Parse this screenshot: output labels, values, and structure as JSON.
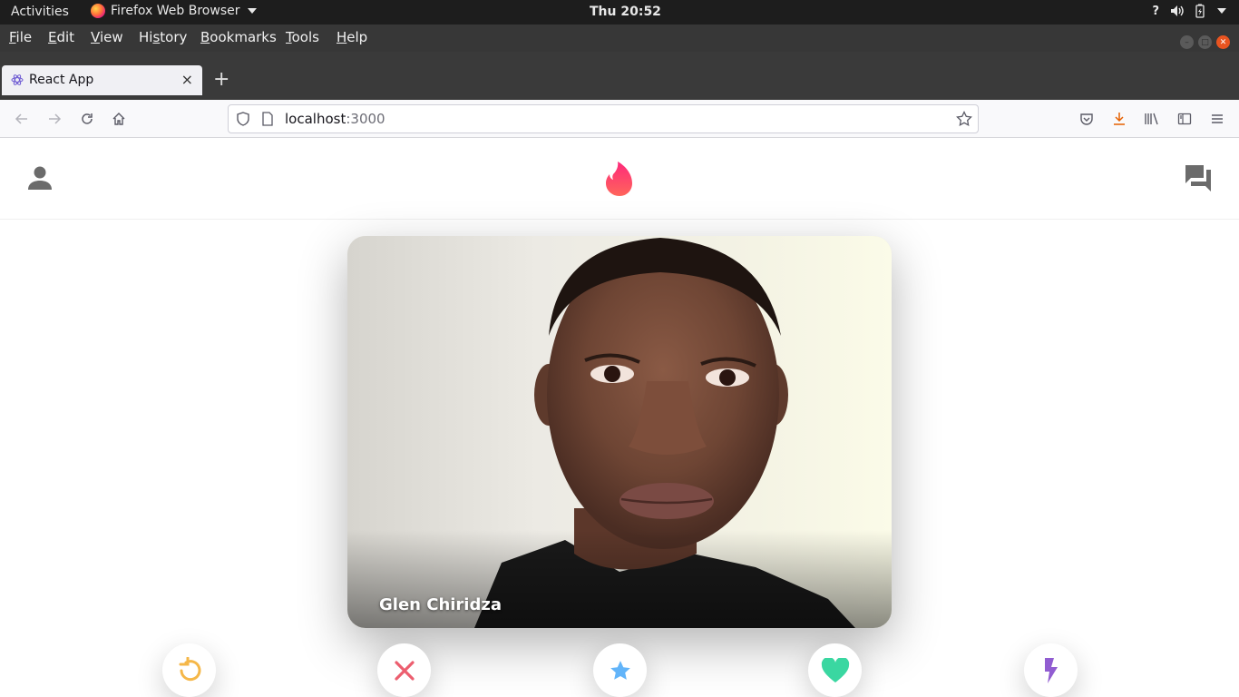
{
  "system": {
    "activities": "Activities",
    "app_name": "Firefox Web Browser",
    "clock": "Thu 20:52",
    "tray_help": "?"
  },
  "menubar": {
    "items": [
      {
        "accel": "F",
        "rest": "ile"
      },
      {
        "accel": "E",
        "rest": "dit"
      },
      {
        "accel": "V",
        "rest": "iew"
      },
      {
        "pre": "Hi",
        "accel": "s",
        "rest": "tory"
      },
      {
        "accel": "B",
        "rest": "ookmarks"
      },
      {
        "accel": "T",
        "rest": "ools"
      },
      {
        "accel": "H",
        "rest": "elp"
      }
    ]
  },
  "tabs": [
    {
      "title": "React App",
      "close": "×"
    }
  ],
  "newtab": "+",
  "urlbar": {
    "host": "localhost",
    "port": ":3000"
  },
  "app": {
    "logo_colors": {
      "top": "#fd297b",
      "bottom": "#ff655b"
    },
    "icon_color": "#6b6b6b"
  },
  "card": {
    "name": "Glen Chiridza"
  },
  "actions": {
    "replay_color": "#f5b748",
    "close_color": "#ec5e6f",
    "star_color": "#62b4f9",
    "heart_color": "#3ad7a1",
    "flash_color": "#915dd1"
  }
}
